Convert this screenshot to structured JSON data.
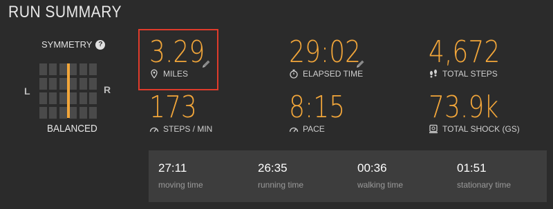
{
  "header": {
    "title": "RUN SUMMARY"
  },
  "symmetry": {
    "title": "SYMMETRY",
    "left_label": "L",
    "right_label": "R",
    "status": "BALANCED",
    "balance_fraction": 0.5
  },
  "stats": {
    "distance": {
      "value": "3.29",
      "label": "MILES",
      "icon": "location-pin-icon"
    },
    "elapsed_time": {
      "value": "29:02",
      "label": "ELAPSED TIME",
      "icon": "stopwatch-icon"
    },
    "total_steps": {
      "value": "4,672",
      "label": "TOTAL STEPS",
      "icon": "footsteps-icon"
    },
    "cadence": {
      "value": "173",
      "label": "STEPS / MIN",
      "icon": "speedometer-icon"
    },
    "pace": {
      "value": "8:15",
      "label": "PACE",
      "icon": "speedometer-icon"
    },
    "total_shock": {
      "value": "73.9k",
      "label": "TOTAL SHOCK (Gs)",
      "icon": "scale-icon"
    }
  },
  "times": [
    {
      "value": "27:11",
      "label": "moving time"
    },
    {
      "value": "26:35",
      "label": "running time"
    },
    {
      "value": "00:36",
      "label": "walking time"
    },
    {
      "value": "01:51",
      "label": "stationary time"
    }
  ],
  "colors": {
    "accent": "#f2a63a",
    "highlight": "#e03b2b",
    "background": "#2b2b2b",
    "panel": "#3d3d3d"
  }
}
